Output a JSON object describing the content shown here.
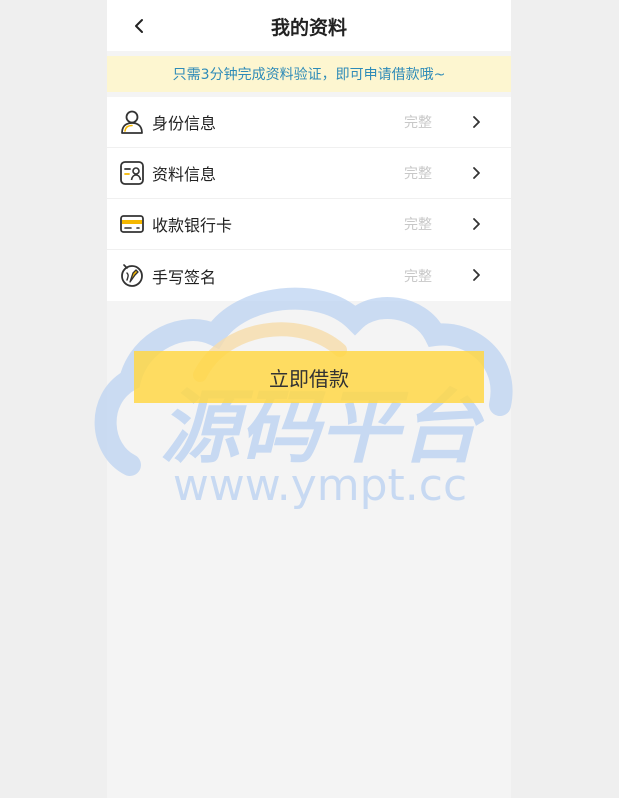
{
  "header": {
    "title": "我的资料",
    "back_icon": "chevron-left-icon"
  },
  "notice": {
    "text": "只需3分钟完成资料验证，即可申请借款哦~"
  },
  "profile_items": [
    {
      "label": "身份信息",
      "status": "完整",
      "icon": "user-icon"
    },
    {
      "label": "资料信息",
      "status": "完整",
      "icon": "id-card-icon"
    },
    {
      "label": "收款银行卡",
      "status": "完整",
      "icon": "bank-card-icon"
    },
    {
      "label": "手写签名",
      "status": "完整",
      "icon": "signature-icon"
    }
  ],
  "submit": {
    "label": "立即借款"
  },
  "watermark": {
    "logo_text": "源码平台",
    "url_text": "www.ympt.cc"
  },
  "colors": {
    "notice_bg": "#fdf6d0",
    "notice_text": "#2e8bb8",
    "button_bg": "#ffd746",
    "status_text": "#c8c8c8",
    "icon_accent": "#f5b800"
  }
}
